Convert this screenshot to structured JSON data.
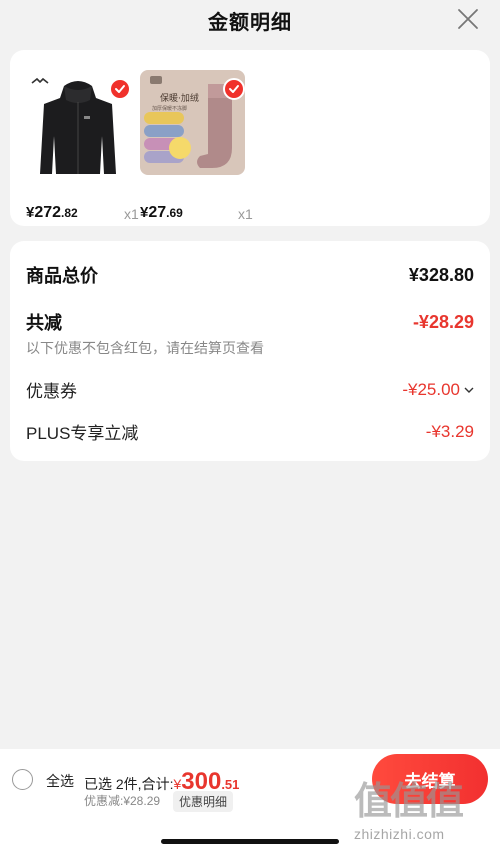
{
  "header": {
    "title": "金额明细",
    "close_icon": "close-icon"
  },
  "products": [
    {
      "name": "jacket",
      "price_int": "272",
      "price_cents": ".82",
      "yen": "¥",
      "qty": "x1",
      "checked": true
    },
    {
      "name": "socks",
      "price_int": "27",
      "price_cents": ".69",
      "yen": "¥",
      "qty": "x1",
      "checked": true,
      "image_text": {
        "top": "保暖·加绒",
        "mid": "加厚保暖不冻脚"
      }
    }
  ],
  "summary": {
    "total_label": "商品总价",
    "total_value": "¥328.80",
    "discount_label": "共减",
    "discount_value": "-¥28.29",
    "note": "以下优惠不包含红包，请在结算页查看",
    "coupon_label": "优惠券",
    "coupon_value": "-¥25.00",
    "plus_label": "PLUS专享立减",
    "plus_value": "-¥3.29"
  },
  "bottom": {
    "select_all": "全选",
    "selected_info": "已选 2件,合计:",
    "amount_yen": "¥",
    "amount_int": "300",
    "amount_cents": ".51",
    "discount_info": "优惠减:¥28.29",
    "detail_button": "优惠明细",
    "checkout_button": "去结算"
  },
  "watermark": {
    "logo": "值值值",
    "url": "zhizhizhi.com"
  },
  "colors": {
    "accent_red": "#e8362e",
    "check_red": "#f0312b",
    "bg": "#f2f2f2"
  }
}
